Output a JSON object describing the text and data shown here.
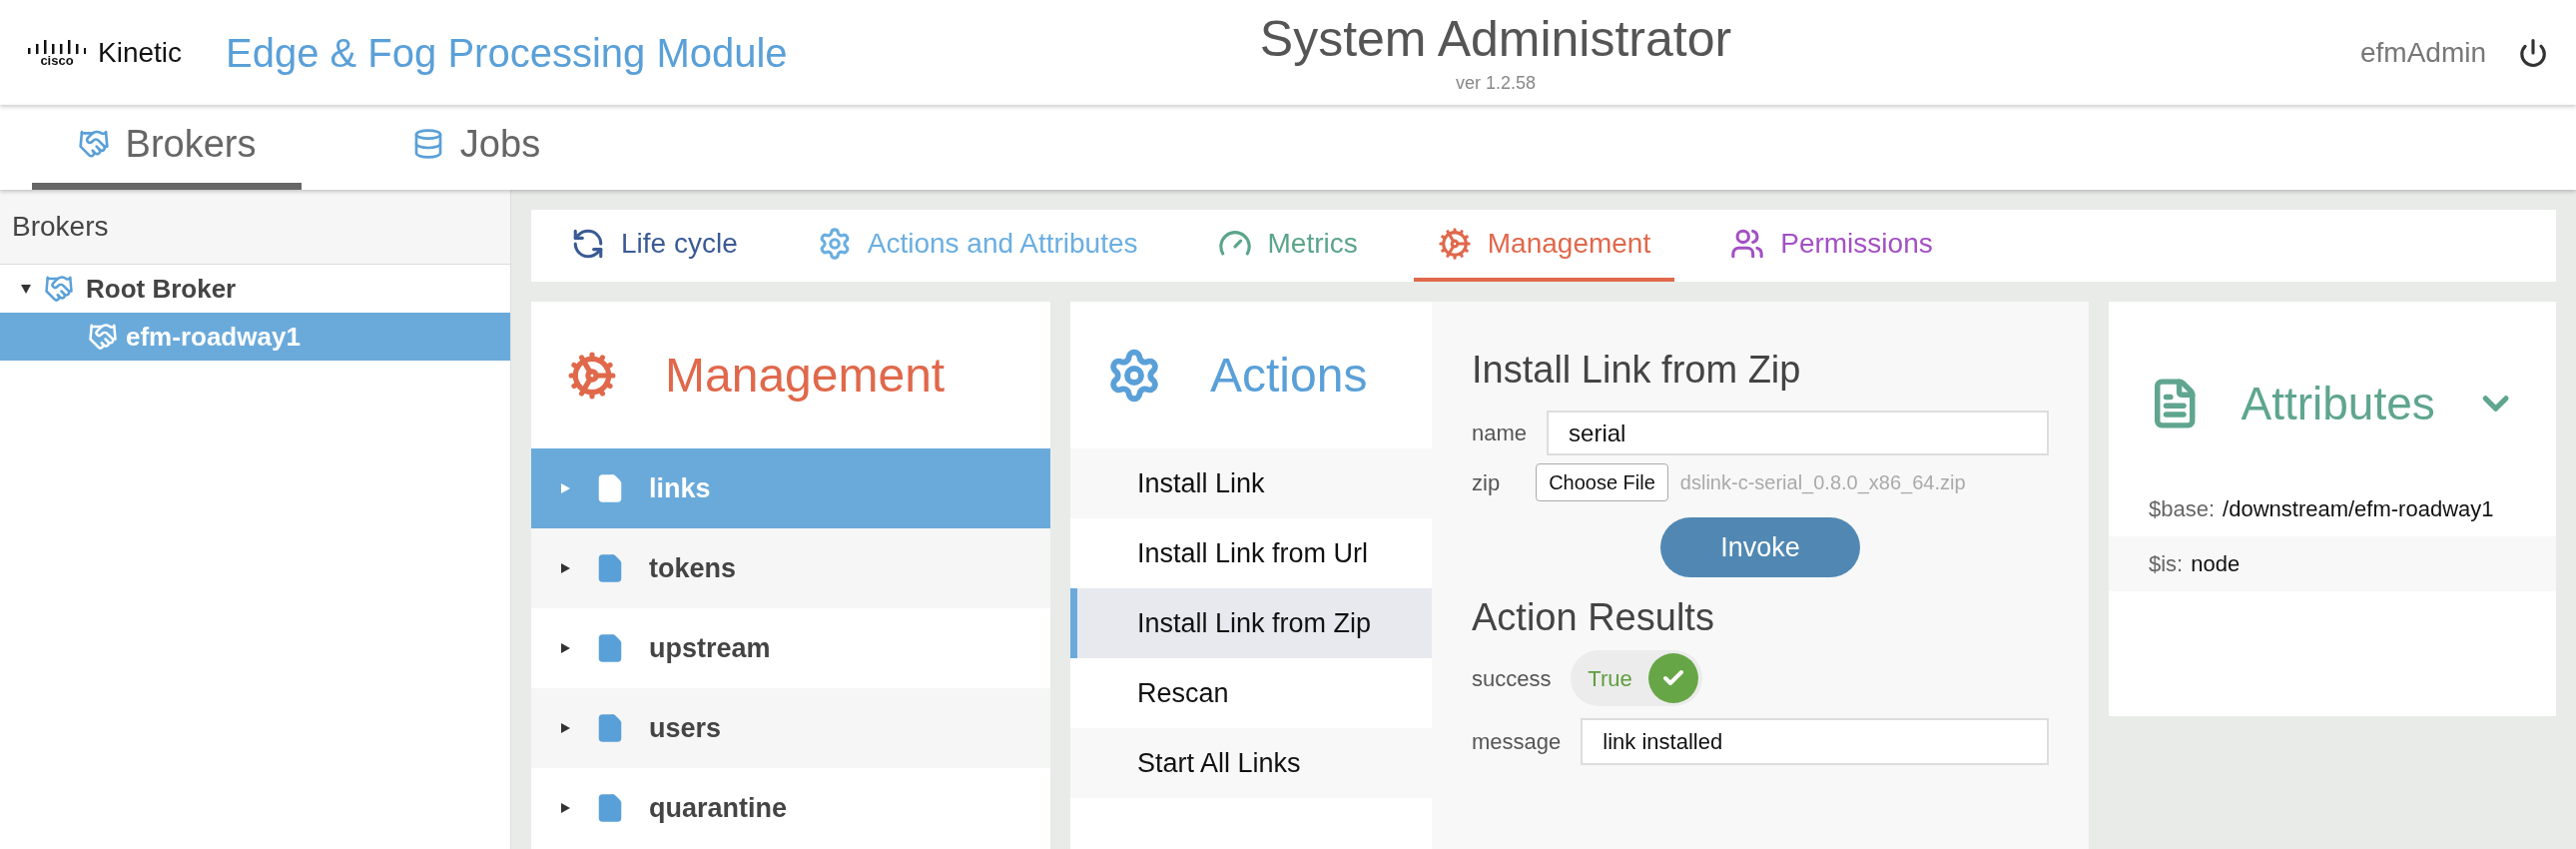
{
  "header": {
    "logo_brand": "cisco",
    "logo_product": "Kinetic",
    "app_title": "Edge & Fog Processing Module",
    "page_title": "System Administrator",
    "version": "ver 1.2.58",
    "user": "efmAdmin"
  },
  "nav_tabs": [
    {
      "label": "Brokers",
      "kind": "brokers",
      "selected": true
    },
    {
      "label": "Jobs",
      "kind": "jobs",
      "selected": false
    }
  ],
  "sidebar": {
    "title": "Brokers",
    "tree": [
      {
        "label": "Root Broker",
        "expanded": true,
        "selected": false,
        "children": [
          {
            "label": "efm-roadway1",
            "selected": true
          }
        ]
      }
    ]
  },
  "tabs": [
    {
      "label": "Life cycle",
      "kind": "lifecycle",
      "color": "#3a5a94",
      "selected": false
    },
    {
      "label": "Actions and Attributes",
      "kind": "actions",
      "color": "#6aaee0",
      "selected": false
    },
    {
      "label": "Metrics",
      "kind": "metrics",
      "color": "#5aa58a",
      "selected": false
    },
    {
      "label": "Management",
      "kind": "management",
      "color": "#e0684b",
      "selected": true
    },
    {
      "label": "Permissions",
      "kind": "permissions",
      "color": "#a350c4",
      "selected": false
    }
  ],
  "management": {
    "title": "Management",
    "items": [
      {
        "label": "links",
        "selected": true
      },
      {
        "label": "tokens",
        "selected": false
      },
      {
        "label": "upstream",
        "selected": false
      },
      {
        "label": "users",
        "selected": false
      },
      {
        "label": "quarantine",
        "selected": false
      }
    ]
  },
  "actions": {
    "title": "Actions",
    "items": [
      {
        "label": "Install Link",
        "selected": false
      },
      {
        "label": "Install Link from Url",
        "selected": false
      },
      {
        "label": "Install Link from Zip",
        "selected": true
      },
      {
        "label": "Rescan",
        "selected": false
      },
      {
        "label": "Start All Links",
        "selected": false
      }
    ]
  },
  "form": {
    "title": "Install Link from Zip",
    "name_label": "name",
    "name_value": "serial",
    "zip_label": "zip",
    "zip_button": "Choose File",
    "zip_file": "dslink-c-serial_0.8.0_x86_64.zip",
    "invoke": "Invoke"
  },
  "results": {
    "title": "Action Results",
    "success_label": "success",
    "success_value": "True",
    "success_on": true,
    "message_label": "message",
    "message_value": "link installed"
  },
  "attributes": {
    "title": "Attributes",
    "expanded": true,
    "rows": [
      {
        "key": "$base:",
        "value": "/downstream/efm-roadway1"
      },
      {
        "key": "$is:",
        "value": "node"
      }
    ]
  }
}
